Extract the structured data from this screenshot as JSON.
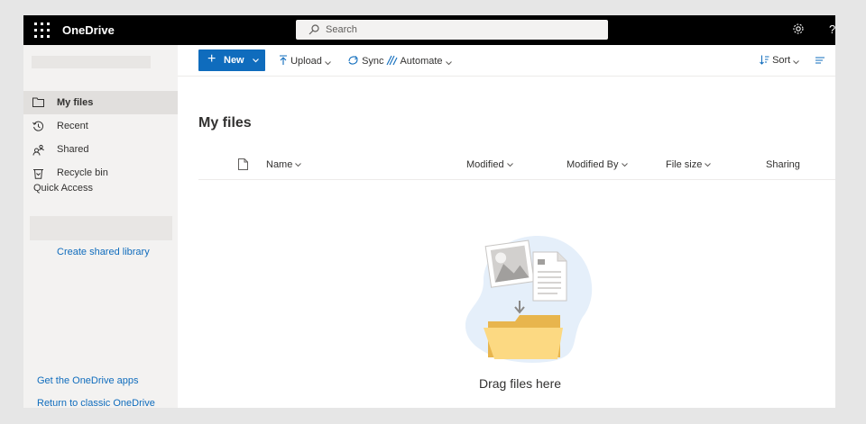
{
  "topbar": {
    "app_name": "OneDrive",
    "search_placeholder": "Search",
    "help_label": "?"
  },
  "sidebar": {
    "items": [
      {
        "label": "My files",
        "icon": "folder-icon",
        "active": true
      },
      {
        "label": "Recent",
        "icon": "clock-icon",
        "active": false
      },
      {
        "label": "Shared",
        "icon": "shared-people-icon",
        "active": false
      },
      {
        "label": "Recycle bin",
        "icon": "recycle-bin-icon",
        "active": false
      }
    ],
    "quick_access_label": "Quick Access",
    "create_shared_library": "Create shared library",
    "get_apps": "Get the OneDrive apps",
    "return_classic": "Return to classic OneDrive"
  },
  "commandbar": {
    "new_label": "New",
    "upload_label": "Upload",
    "sync_label": "Sync",
    "automate_label": "Automate",
    "sort_label": "Sort"
  },
  "main": {
    "title": "My files",
    "columns": [
      "Name",
      "Modified",
      "Modified By",
      "File size",
      "Sharing"
    ],
    "empty_text": "Drag files here"
  },
  "colors": {
    "accent": "#0f6cbd",
    "topbar": "#000000",
    "sidebar": "#f3f2f1"
  }
}
